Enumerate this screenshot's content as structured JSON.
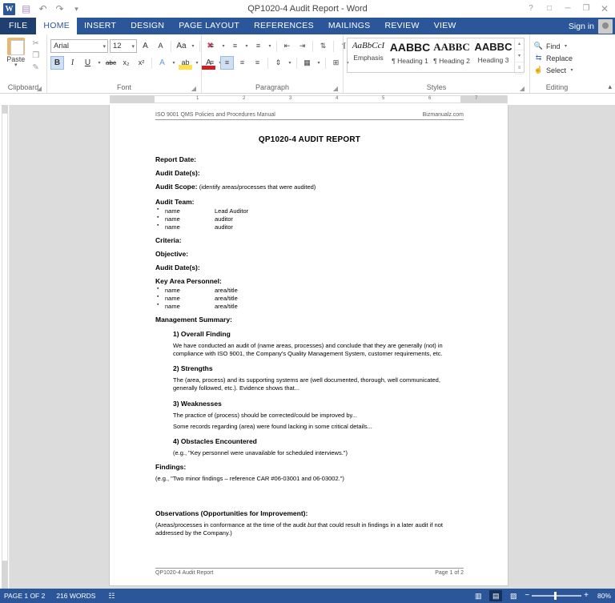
{
  "titlebar": {
    "document_title": "QP1020-4 Audit Report - Word",
    "quick_access": [
      {
        "name": "word-logo",
        "glyph": "W"
      },
      {
        "name": "save-icon",
        "glyph": "▤"
      },
      {
        "name": "undo-icon",
        "glyph": "↶"
      },
      {
        "name": "redo-icon",
        "glyph": "↷"
      },
      {
        "name": "customize-qat-icon",
        "glyph": "▾"
      }
    ],
    "window_buttons": [
      {
        "name": "help-button",
        "glyph": "?"
      },
      {
        "name": "ribbon-display-options-button",
        "glyph": "□"
      },
      {
        "name": "minimize-button",
        "glyph": "─"
      },
      {
        "name": "restore-button",
        "glyph": "❐"
      },
      {
        "name": "close-button",
        "glyph": "✕"
      }
    ]
  },
  "tabs": {
    "file_label": "FILE",
    "items": [
      "HOME",
      "INSERT",
      "DESIGN",
      "PAGE LAYOUT",
      "REFERENCES",
      "MAILINGS",
      "REVIEW",
      "VIEW"
    ],
    "active": "HOME",
    "sign_in": "Sign in"
  },
  "ribbon": {
    "clipboard": {
      "label": "Clipboard",
      "paste_label": "Paste",
      "paste_caret": "▾",
      "cut_icon": "✂",
      "copy_icon": "❐",
      "format_painter_icon": "὘C",
      "dialog_launcher": "⬌"
    },
    "font": {
      "label": "Font",
      "font_name": "Arial",
      "font_size": "12",
      "grow_font": "A",
      "shrink_font": "A",
      "change_case": "Aa",
      "clear_formatting": "✐",
      "bold": "B",
      "italic": "I",
      "underline": "U",
      "strikethrough": "abc",
      "subscript": "x₂",
      "superscript": "x²",
      "text_effects": "A",
      "highlight": "ab",
      "font_color": "A",
      "dialog_launcher": "⬌"
    },
    "paragraph": {
      "label": "Paragraph",
      "bullets": "☰",
      "numbering": "☰",
      "multilevel": "☰",
      "decrease_indent": "⇤",
      "increase_indent": "⇥",
      "sort": "⇅",
      "show_marks": "¶",
      "align_left": "☰",
      "align_center": "☰",
      "align_right": "☰",
      "justify": "☰",
      "line_spacing": "↨",
      "shading": "▣",
      "borders": "⊞",
      "dialog_launcher": "⬌"
    },
    "styles": {
      "label": "Styles",
      "dialog_launcher": "⬌",
      "items": [
        {
          "preview": "AaBbCcI",
          "name": "Emphasis",
          "kind": "emph"
        },
        {
          "preview": "AABBC",
          "name": "¶ Heading 1",
          "kind": "h1"
        },
        {
          "preview": "AABBC\u0001",
          "name": "¶ Heading 2",
          "kind": "h2"
        },
        {
          "preview": "AABBC",
          "name": "Heading 3",
          "kind": "h3"
        }
      ],
      "scroll_up": "▴",
      "scroll_down": "▾",
      "more": "≡"
    },
    "editing": {
      "label": "Editing",
      "find": "Find",
      "find_caret": "▾",
      "replace": "Replace",
      "select": "Select",
      "select_caret": "▾",
      "find_icon": "🔍",
      "replace_icon": "⇆",
      "select_icon": "↖"
    },
    "collapse_icon": "▴"
  },
  "ruler": {
    "ticks": [
      "1",
      "2",
      "3",
      "4",
      "5",
      "6",
      "7"
    ]
  },
  "document": {
    "header_left": "ISO 9001 QMS Policies and Procedures Manual",
    "header_right": "Bizmanualz.com",
    "title": "QP1020-4 AUDIT REPORT",
    "report_date_label": "Report Date:",
    "audit_dates_label": "Audit Date(s):",
    "audit_scope_label": "Audit Scope:",
    "audit_scope_hint": "(identify areas/processes that were audited)",
    "audit_team_label": "Audit Team:",
    "audit_team": [
      {
        "name": "name",
        "role": "Lead Auditor"
      },
      {
        "name": "name",
        "role": "auditor"
      },
      {
        "name": "name",
        "role": "auditor"
      }
    ],
    "criteria_label": "Criteria:",
    "objective_label": "Objective:",
    "audit_dates_label_2": "Audit Date(s):",
    "key_personnel_label": "Key Area Personnel:",
    "key_personnel": [
      {
        "name": "name",
        "role": "area/title"
      },
      {
        "name": "name",
        "role": "area/title"
      },
      {
        "name": "name",
        "role": "area/title"
      }
    ],
    "management_summary_label": "Management Summary:",
    "sections": [
      {
        "heading": "1) Overall Finding",
        "paragraphs": [
          "We have conducted an audit of (name areas, processes) and conclude that they are generally (not) in compliance with ISO 9001, the Company's Quality Management System, customer requirements, etc."
        ]
      },
      {
        "heading": "2) Strengths",
        "paragraphs": [
          "The (area, process) and its supporting systems are (well documented, thorough, well communicated, generally followed, etc.).  Evidence shows that..."
        ]
      },
      {
        "heading": "3) Weaknesses",
        "paragraphs": [
          "The practice of (process) should be corrected/could be improved by...",
          "Some records regarding (area) were found lacking in some critical details..."
        ]
      },
      {
        "heading": "4) Obstacles Encountered",
        "paragraphs": [
          "(e.g., \"Key personnel were unavailable for scheduled interviews.\")"
        ]
      }
    ],
    "findings_label": "Findings:",
    "findings_text": "(e.g., \"Two minor findings – reference CAR #06-03001 and 06-03002.\")",
    "observations_label": "Observations (Opportunities for Improvement):",
    "observations_pre": "(Areas/processes in conformance at the time of the audit ",
    "observations_em": "but",
    "observations_post": " that could result in findings in a later audit if not addressed by the Company.)",
    "footer_left": "QP1020-4 Audit Report",
    "footer_right": "Page 1 of 2"
  },
  "status": {
    "page_indicator": "PAGE 1 OF 2",
    "word_count": "216 WORDS",
    "proofing_icon": "⌨",
    "views": [
      {
        "name": "read-mode-button",
        "glyph": "▥",
        "active": false
      },
      {
        "name": "print-layout-button",
        "glyph": "▤",
        "active": true
      },
      {
        "name": "web-layout-button",
        "glyph": "▨",
        "active": false
      }
    ],
    "zoom_out": "−",
    "zoom_in": "+",
    "zoom_level": "80%"
  }
}
